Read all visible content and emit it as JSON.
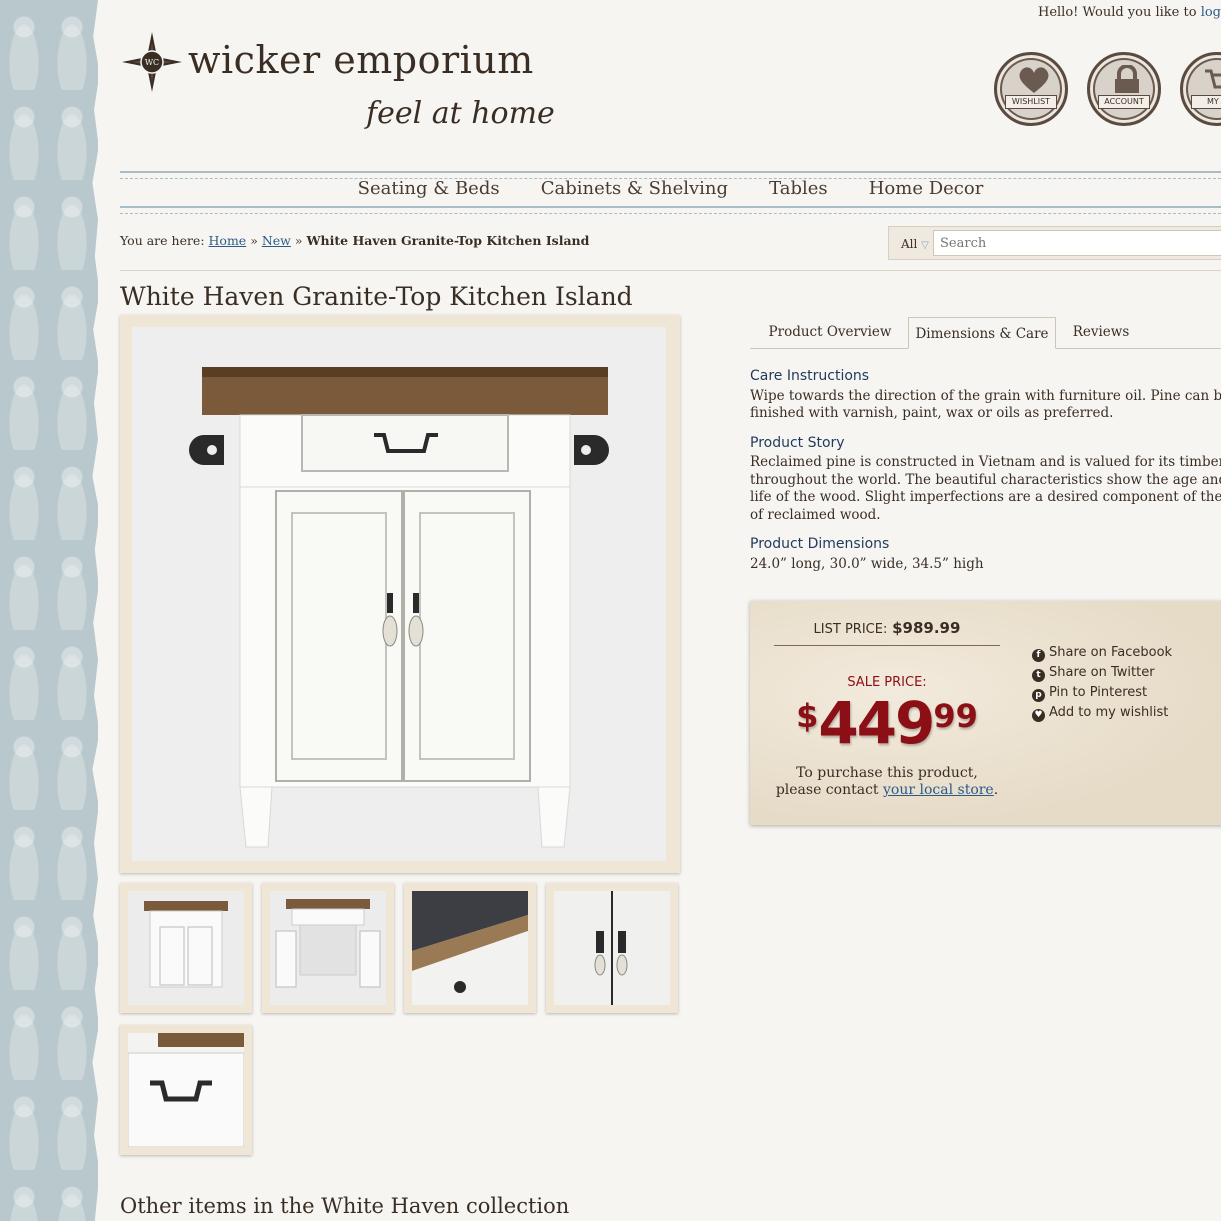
{
  "header": {
    "greeting": "Hello! Would you like to ",
    "greeting_link": "log",
    "brand": "wicker emporium",
    "tagline": "feel at home",
    "logo_monogram": "WC",
    "badges": [
      {
        "label": "WISHLIST",
        "icon": "heart-icon"
      },
      {
        "label": "ACCOUNT",
        "icon": "lock-icon"
      },
      {
        "label": "MY C",
        "icon": "cart-icon"
      }
    ]
  },
  "nav": {
    "items": [
      "Seating & Beds",
      "Cabinets & Shelving",
      "Tables",
      "Home Decor"
    ]
  },
  "breadcrumb": {
    "prefix": "You are here: ",
    "home": "Home",
    "sep": " » ",
    "new": "New",
    "current": "White Haven Granite-Top Kitchen Island"
  },
  "search": {
    "scope": "All",
    "placeholder": "Search"
  },
  "product": {
    "title": "White Haven Granite-Top Kitchen Island",
    "tabs": [
      "Product Overview",
      "Dimensions & Care",
      "Reviews"
    ],
    "active_tab": "Dimensions & Care",
    "care_heading": "Care Instructions",
    "care_lines": [
      "Wipe towards the direction of the grain with furniture oil. Pine can be",
      "finished with varnish, paint, wax or oils as preferred."
    ],
    "story_heading": "Product Story",
    "story_lines": [
      "Reclaimed pine is constructed in Vietnam and is valued for its timber and",
      "throughout the world. The beautiful characteristics show the age and pre",
      "life of the wood. Slight imperfections are a desired component of the esth",
      "of reclaimed wood."
    ],
    "dims_heading": "Product Dimensions",
    "dims": "24.0” long, 30.0” wide, 34.5” high"
  },
  "pricing": {
    "list_label": "LIST PRICE:",
    "list_price": "$989.99",
    "sale_label": "SALE PRICE:",
    "sale_dollar_sign": "$",
    "sale_whole": "449",
    "sale_cents": "99",
    "purchase_line1": "To purchase this product,",
    "purchase_line2": "please contact ",
    "purchase_link": "your local store",
    "purchase_end": "."
  },
  "share": [
    {
      "label": "Share on Facebook",
      "glyph": "f"
    },
    {
      "label": "Share on Twitter",
      "glyph": "t"
    },
    {
      "label": "Pin to Pinterest",
      "glyph": "p"
    },
    {
      "label": "Add to my wishlist",
      "glyph": "♥"
    }
  ],
  "collection_heading": "Other items in the White Haven collection",
  "colors": {
    "sale_red": "#8b0f14",
    "link_blue": "#2a5a8a",
    "brown_text": "#3a2e24"
  }
}
